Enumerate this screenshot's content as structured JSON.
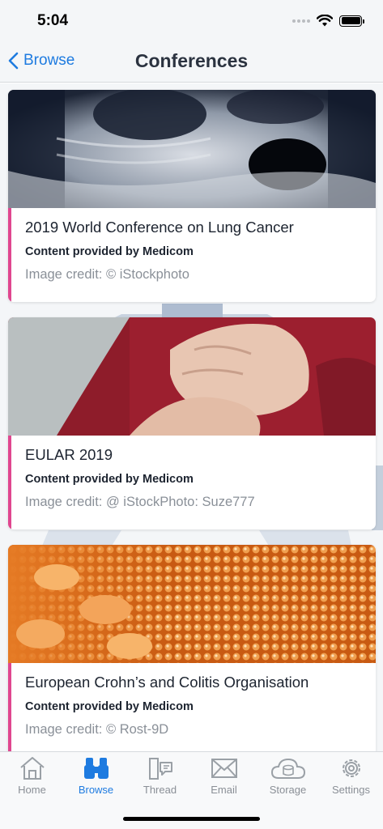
{
  "status": {
    "time": "5:04"
  },
  "nav": {
    "back_label": "Browse",
    "title": "Conferences"
  },
  "cards": [
    {
      "title": "2019 World Conference on Lung Cancer",
      "provider": "Content provided by Medicom",
      "credit": "Image credit: © iStockphoto"
    },
    {
      "title": "EULAR 2019",
      "provider": "Content provided by Medicom",
      "credit": "Image credit: @ iStockPhoto: Suze777"
    },
    {
      "title": "European Crohn’s and Colitis Organisation",
      "provider": "Content provided by Medicom",
      "credit": "Image credit: © Rost-9D"
    }
  ],
  "tabs": [
    {
      "label": "Home",
      "icon": "house-icon"
    },
    {
      "label": "Browse",
      "icon": "binoculars-icon",
      "active": true
    },
    {
      "label": "Thread",
      "icon": "thread-icon"
    },
    {
      "label": "Email",
      "icon": "envelope-icon"
    },
    {
      "label": "Storage",
      "icon": "cloud-storage-icon"
    },
    {
      "label": "Settings",
      "icon": "gear-icon"
    }
  ],
  "colors": {
    "accent": "#1e7be0",
    "card_stripe": "#e0468f"
  }
}
